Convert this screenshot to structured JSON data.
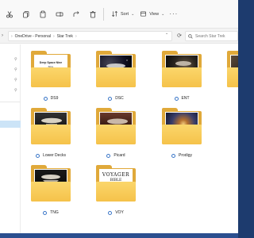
{
  "window": {
    "toolbar": {
      "sort_label": "Sort",
      "view_label": "View",
      "more_label": "···"
    },
    "address": {
      "crumbs": [
        "OneDrive - Personal",
        "Star Trek"
      ]
    },
    "search": {
      "placeholder": "Search Star Trek"
    },
    "folders": [
      {
        "name": "DS9",
        "thumb_title": "Deep Space Nine",
        "thumb_sub": "Bible"
      },
      {
        "name": "DSC"
      },
      {
        "name": "ENT"
      },
      {
        "name": "Lower Decks"
      },
      {
        "name": "Picard"
      },
      {
        "name": "Prodigy"
      },
      {
        "name": "TNG"
      },
      {
        "name": "VOY",
        "thumb_title": "VOYAGER",
        "thumb_sub": "BIBLE"
      }
    ]
  },
  "colors": {
    "folder_back": "#e0a93a",
    "folder_front": "#f5c24a",
    "selection": "#cce4f7",
    "wallpaper": "#1d3b6e"
  },
  "icons": [
    "cut-icon",
    "copy-icon",
    "paste-icon",
    "rename-icon",
    "share-icon",
    "delete-icon",
    "sort-icon",
    "view-icon",
    "refresh-icon",
    "search-icon",
    "pin-icon",
    "sync-status-icon"
  ]
}
